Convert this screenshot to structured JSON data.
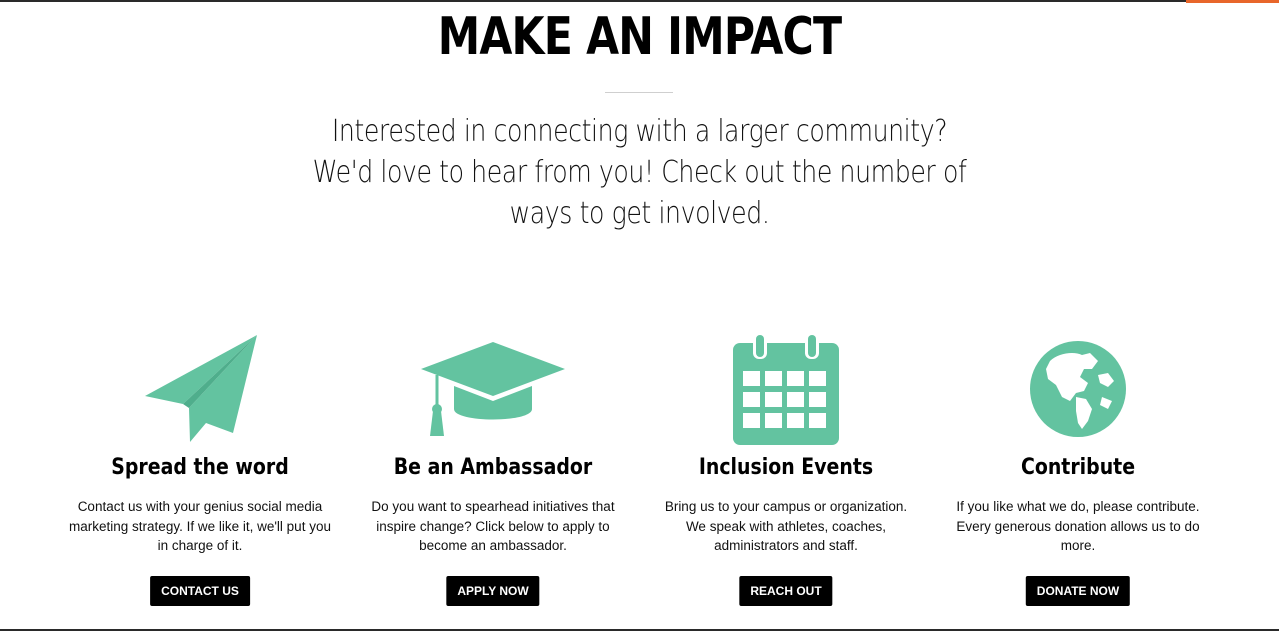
{
  "page": {
    "title": "MAKE AN IMPACT",
    "intro": "Interested in connecting with a larger community? We'd love to hear from you! Check out the number of ways to get involved."
  },
  "colors": {
    "icon": "#63c3a0",
    "button_bg": "#000000",
    "button_text": "#ffffff",
    "accent": "#e8662a"
  },
  "cards": [
    {
      "icon": "paper-plane-icon",
      "heading": "Spread the word",
      "text": "Contact us with your genius social media marketing strategy. If we like it, we'll put you in charge of it.",
      "button": "CONTACT US"
    },
    {
      "icon": "graduation-cap-icon",
      "heading": "Be an Ambassador",
      "text": "Do you want to spearhead initiatives that inspire change? Click below to apply to become an ambassador.",
      "button": "APPLY NOW"
    },
    {
      "icon": "calendar-icon",
      "heading": "Inclusion Events",
      "text": "Bring us to your campus or organization. We speak with athletes, coaches, administrators and staff.",
      "button": "REACH OUT"
    },
    {
      "icon": "globe-icon",
      "heading": "Contribute",
      "text": "If you like what we do, please contribute. Every generous donation allows us to do more.",
      "button": "DONATE NOW"
    }
  ]
}
